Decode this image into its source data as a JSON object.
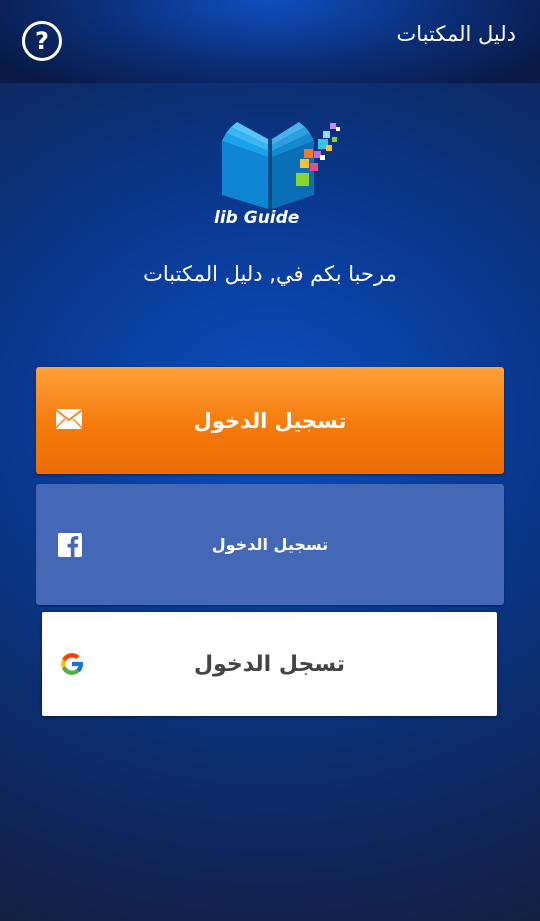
{
  "header": {
    "title": "دليل المكتبات",
    "help_icon": "help-circle-icon",
    "help_symbol": "?"
  },
  "logo": {
    "text": "lib Guide",
    "icon": "open-book-icon"
  },
  "welcome": {
    "text": "مرحبا بكم في, دليل المكتبات"
  },
  "buttons": {
    "email": {
      "label": "تسجيل الدخول",
      "icon": "mail-icon",
      "color": "#f57a0c"
    },
    "facebook": {
      "label": "تسجيل الدخول",
      "icon": "facebook-icon",
      "color": "#4468b6"
    },
    "google": {
      "label": "تسجل الدخول",
      "icon": "google-icon",
      "color": "#ffffff"
    }
  },
  "colors": {
    "background": "#0a3a94",
    "accent_orange": "#f57a0c",
    "facebook_blue": "#4468b6"
  }
}
